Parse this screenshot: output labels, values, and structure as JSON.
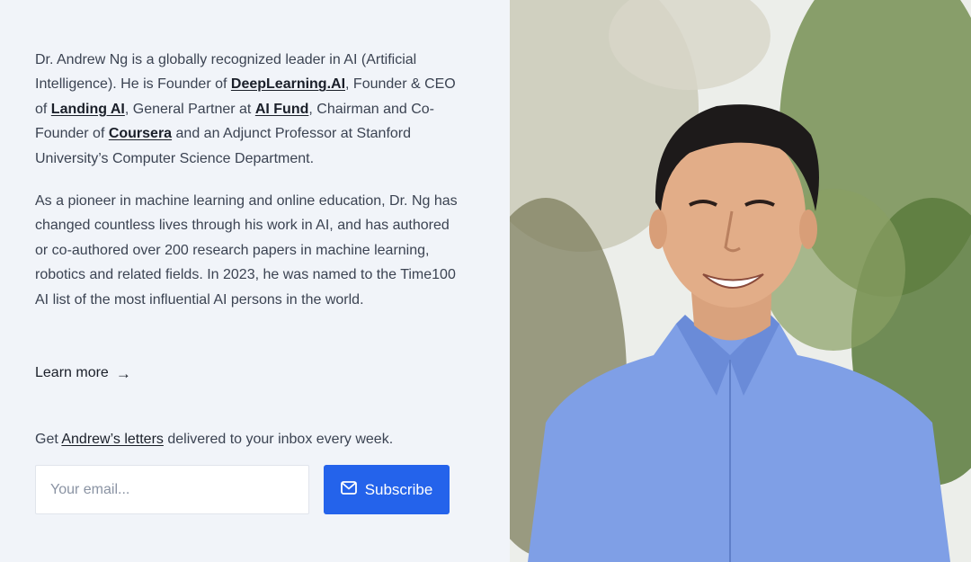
{
  "bio": {
    "p1": {
      "t1": "Dr. Andrew Ng is a globally recognized leader in AI (Artificial Intelligence). He is Founder of ",
      "link1": "DeepLearning.AI",
      "t2": ", Founder & CEO of ",
      "link2": "Landing AI",
      "t3": ", General Partner at ",
      "link3": "AI Fund",
      "t4": ", Chairman and Co-Founder of ",
      "link4": "Coursera",
      "t5": " and an Adjunct Professor at Stanford University’s Computer Science Department."
    },
    "p2": "As a pioneer in machine learning and online education, Dr. Ng has changed countless lives through his work in AI, and has authored or co-authored over 200 research papers in machine learning, robotics and related fields. In 2023, he was named to the Time100 AI list of the most influential AI persons in the world."
  },
  "learn_more": {
    "label": "Learn more",
    "arrow": "→"
  },
  "newsletter": {
    "prefix": "Get ",
    "link": "Andrew’s letters",
    "suffix": " delivered to your inbox every week.",
    "email_placeholder": "Your email...",
    "email_value": "",
    "subscribe_label": "Subscribe",
    "subscribe_icon": "mail-icon"
  },
  "colors": {
    "background": "#f1f4f9",
    "accent": "#2463eb",
    "text": "#3b4352",
    "link": "#1a1f29"
  },
  "photo": {
    "icon": "portrait-photo"
  }
}
